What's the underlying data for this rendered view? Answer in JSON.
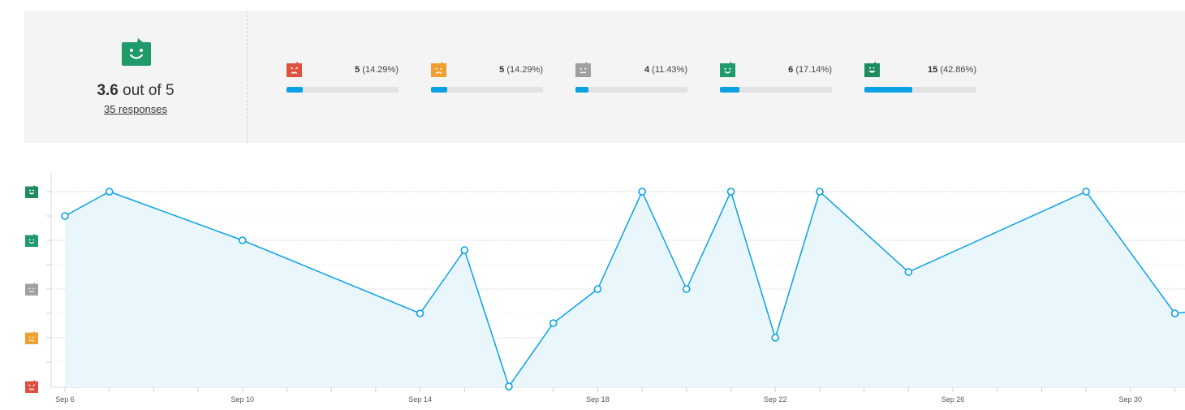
{
  "summary": {
    "score_value": "3.6",
    "score_suffix": " out of 5",
    "responses_label": "35 responses"
  },
  "ratings": [
    {
      "name": "angry",
      "count": "5",
      "percent": "(14.29%)",
      "fraction": 0.1429,
      "color": "#e0503e",
      "icon": "angry-face-icon"
    },
    {
      "name": "sad",
      "count": "5",
      "percent": "(14.29%)",
      "fraction": 0.1429,
      "color": "#f0a030",
      "icon": "sad-face-icon"
    },
    {
      "name": "neutral",
      "count": "4",
      "percent": "(11.43%)",
      "fraction": 0.1143,
      "color": "#a0a0a0",
      "icon": "neutral-face-icon"
    },
    {
      "name": "happy",
      "count": "6",
      "percent": "(17.14%)",
      "fraction": 0.1714,
      "color": "#1f9a6a",
      "icon": "happy-face-icon"
    },
    {
      "name": "love",
      "count": "15",
      "percent": "(42.86%)",
      "fraction": 0.4286,
      "color": "#1f8c60",
      "icon": "love-face-icon"
    }
  ],
  "colors": {
    "accent": "#0ba1e2",
    "fill": "#e9f6fc",
    "overall": "#1f9a6a"
  },
  "chart_data": {
    "type": "area",
    "x_dates": [
      "Sep 6",
      "Sep 7",
      "Sep 10",
      "Sep 14",
      "Sep 15",
      "Sep 16",
      "Sep 17",
      "Sep 18",
      "Sep 19",
      "Sep 20",
      "Sep 21",
      "Sep 22",
      "Sep 23",
      "Sep 25",
      "Sep 29",
      "Oct 1",
      "Oct 2"
    ],
    "x_days": [
      6,
      7,
      10,
      14,
      15,
      16,
      17,
      18,
      19,
      20,
      21,
      22,
      23,
      25,
      29,
      31,
      32
    ],
    "values": [
      4.5,
      5,
      4,
      2.5,
      3.8,
      1,
      2.3,
      3,
      5,
      3,
      5,
      2,
      5,
      3.35,
      5,
      2.5,
      2.6
    ],
    "xticks": [
      {
        "day": 6,
        "label": "Sep 6"
      },
      {
        "day": 10,
        "label": "Sep 10"
      },
      {
        "day": 14,
        "label": "Sep 14"
      },
      {
        "day": 18,
        "label": "Sep 18"
      },
      {
        "day": 22,
        "label": "Sep 22"
      },
      {
        "day": 26,
        "label": "Sep 26"
      },
      {
        "day": 30,
        "label": "Sep 30"
      }
    ],
    "yticks": [
      {
        "value": 1,
        "icon": "angry-face-icon"
      },
      {
        "value": 2,
        "icon": "sad-face-icon"
      },
      {
        "value": 3,
        "icon": "neutral-face-icon"
      },
      {
        "value": 4,
        "icon": "happy-face-icon"
      },
      {
        "value": 5,
        "icon": "love-face-icon"
      }
    ],
    "ylim": [
      1,
      5
    ],
    "grid": true
  }
}
